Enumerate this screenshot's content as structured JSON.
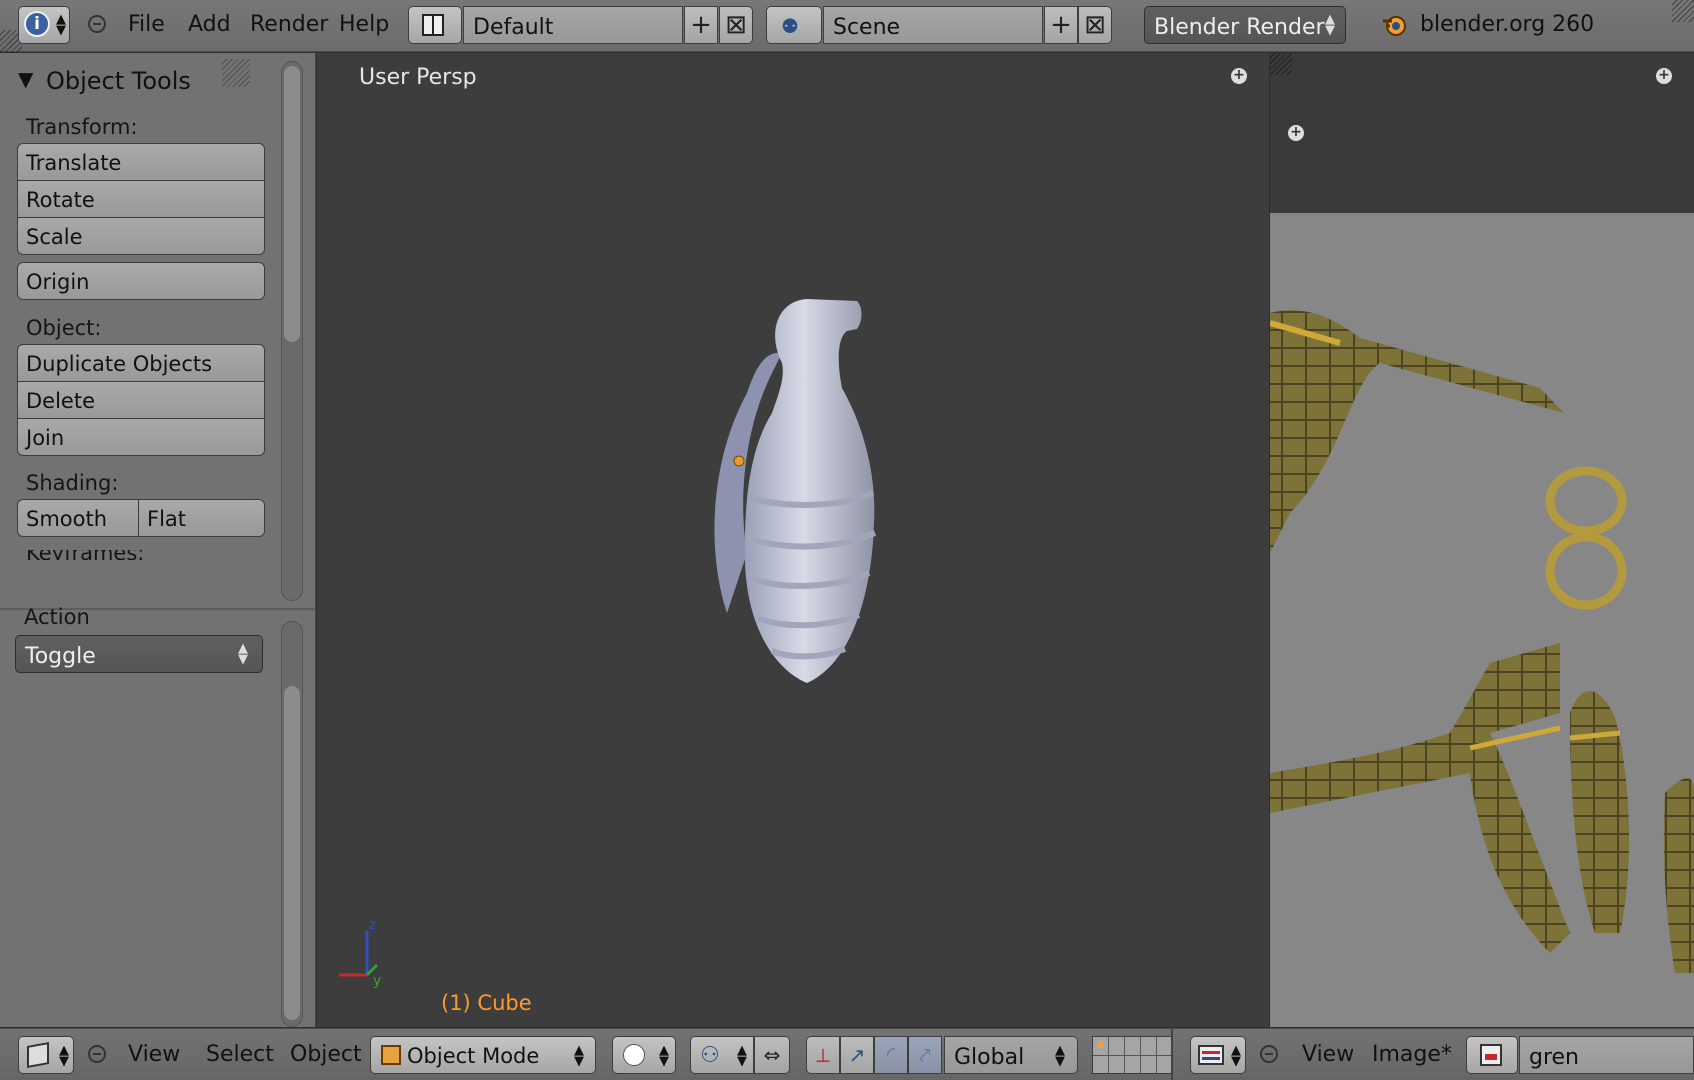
{
  "header": {
    "menu": [
      "File",
      "Add",
      "Render",
      "Help"
    ],
    "screen_layout": "Default",
    "scene": "Scene",
    "render_engine": "Blender Render",
    "version": "blender.org 260"
  },
  "tool_shelf": {
    "panel_title": "Object Tools",
    "transform_label": "Transform:",
    "transform_buttons": [
      "Translate",
      "Rotate",
      "Scale"
    ],
    "origin_button": "Origin",
    "object_label": "Object:",
    "object_buttons": [
      "Duplicate Objects",
      "Delete",
      "Join"
    ],
    "shading_label": "Shading:",
    "shading_buttons": [
      "Smooth",
      "Flat"
    ],
    "keyframes_label": "Keyframes:",
    "action_label": "Action",
    "action_value": "Toggle"
  },
  "viewport": {
    "view_label": "User Persp",
    "object_label": "(1) Cube"
  },
  "bottom_bar": {
    "view_menu": [
      "View",
      "Select",
      "Object"
    ],
    "mode": "Object Mode",
    "orientation": "Global",
    "image_menu": [
      "View",
      "Image*"
    ],
    "image_name": "gren"
  },
  "colors": {
    "accent_orange": "#ff9a2a",
    "viewport_bg": "#3d3d3d",
    "panel_bg": "#727272"
  }
}
